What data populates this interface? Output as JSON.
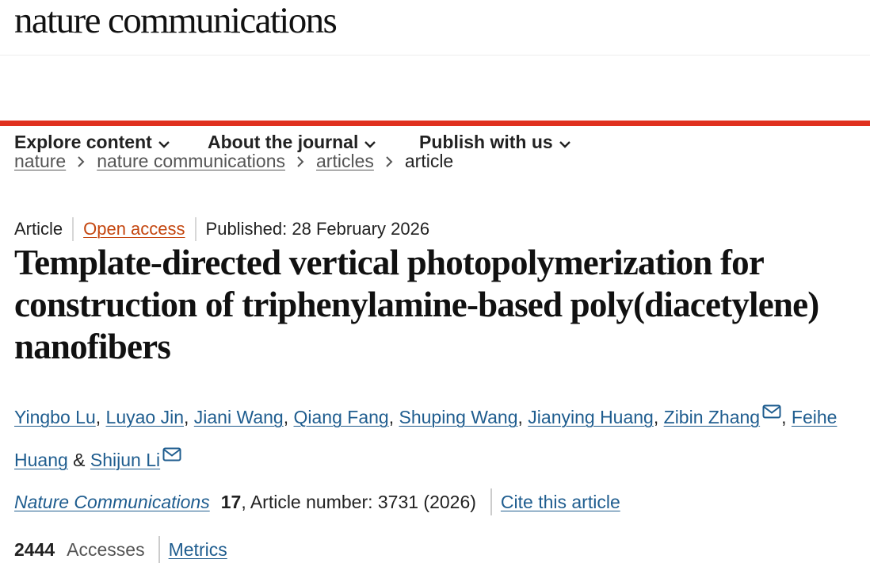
{
  "header": {
    "logo_text": "nature communications"
  },
  "nav": {
    "items": [
      {
        "label": "Explore content"
      },
      {
        "label": "About the journal"
      },
      {
        "label": "Publish with us"
      }
    ]
  },
  "breadcrumb": {
    "items": [
      "nature",
      "nature communications",
      "articles"
    ],
    "current": "article"
  },
  "article": {
    "type": "Article",
    "access": "Open access",
    "published": "Published: 28 February 2026",
    "title": "Template-directed vertical photopolymerization for construction of triphenylamine-based poly(diacetylene) nanofibers",
    "authors": [
      "Yingbo Lu",
      "Luyao Jin",
      "Jiani Wang",
      "Qiang Fang",
      "Shuping Wang",
      "Jianying Huang",
      "Zibin Zhang",
      "Feihe Huang",
      "Shijun Li"
    ],
    "author_sep": ", ",
    "and_sep": " & ",
    "journal": "Nature Communications",
    "volume": "17",
    "article_number": ", Article number: 3731 (2026)",
    "cite_label": "Cite this article",
    "accesses_count": "2444",
    "accesses_label": "Accesses",
    "metrics_label": "Metrics"
  },
  "colors": {
    "accent_red": "#e0301e",
    "link_blue": "#1f5d8f",
    "open_access": "#c4460f"
  },
  "icons": {
    "nav_chevron": "chevron-down-icon",
    "breadcrumb_sep": "chevron-right-icon",
    "corresponding": "mail-icon"
  }
}
